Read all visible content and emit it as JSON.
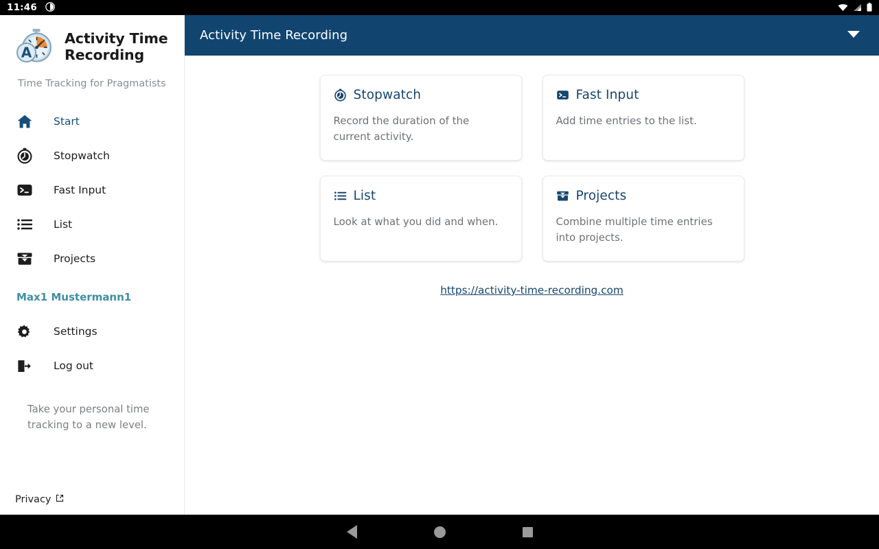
{
  "status_bar": {
    "clock": "11:46",
    "icons": [
      "brightness-icon",
      "wifi-icon",
      "cellular-signal-icon",
      "battery-icon"
    ]
  },
  "sidebar": {
    "brand": {
      "logo_icon": "stopwatch-a-logo",
      "title": "Activity Time Recording",
      "tagline": "Time Tracking for Pragmatists"
    },
    "nav": [
      {
        "label": "Start",
        "icon": "home-icon",
        "active": true
      },
      {
        "label": "Stopwatch",
        "icon": "stopwatch-icon",
        "active": false
      },
      {
        "label": "Fast Input",
        "icon": "terminal-icon",
        "active": false
      },
      {
        "label": "List",
        "icon": "list-icon",
        "active": false
      },
      {
        "label": "Projects",
        "icon": "archive-icon",
        "active": false
      }
    ],
    "user_name": "Max1 Mustermann1",
    "nav_lower": [
      {
        "label": "Settings",
        "icon": "gear-icon"
      },
      {
        "label": "Log out",
        "icon": "logout-icon"
      }
    ],
    "blurb": "Take your personal time tracking to a new level.",
    "privacy": {
      "label": "Privacy",
      "icon": "external-link-icon"
    }
  },
  "topbar": {
    "title": "Activity Time Recording",
    "caret_icon": "chevron-down-icon"
  },
  "content": {
    "cards": [
      {
        "icon": "stopwatch-icon",
        "title": "Stopwatch",
        "desc": "Record the duration of the current activity."
      },
      {
        "icon": "terminal-icon",
        "title": "Fast Input",
        "desc": "Add time entries to the list."
      },
      {
        "icon": "list-icon",
        "title": "List",
        "desc": "Look at what you did and when."
      },
      {
        "icon": "archive-icon",
        "title": "Projects",
        "desc": "Combine multiple time entries into projects."
      }
    ],
    "site_link": "https://activity-time-recording.com"
  },
  "nav_bar": {
    "back": "back-button",
    "home": "home-button",
    "recents": "recents-button"
  },
  "colors": {
    "header_blue": "#114570",
    "accent_navy": "#16456e",
    "user_teal": "#3f8fa6",
    "muted_text": "#6d7276"
  }
}
